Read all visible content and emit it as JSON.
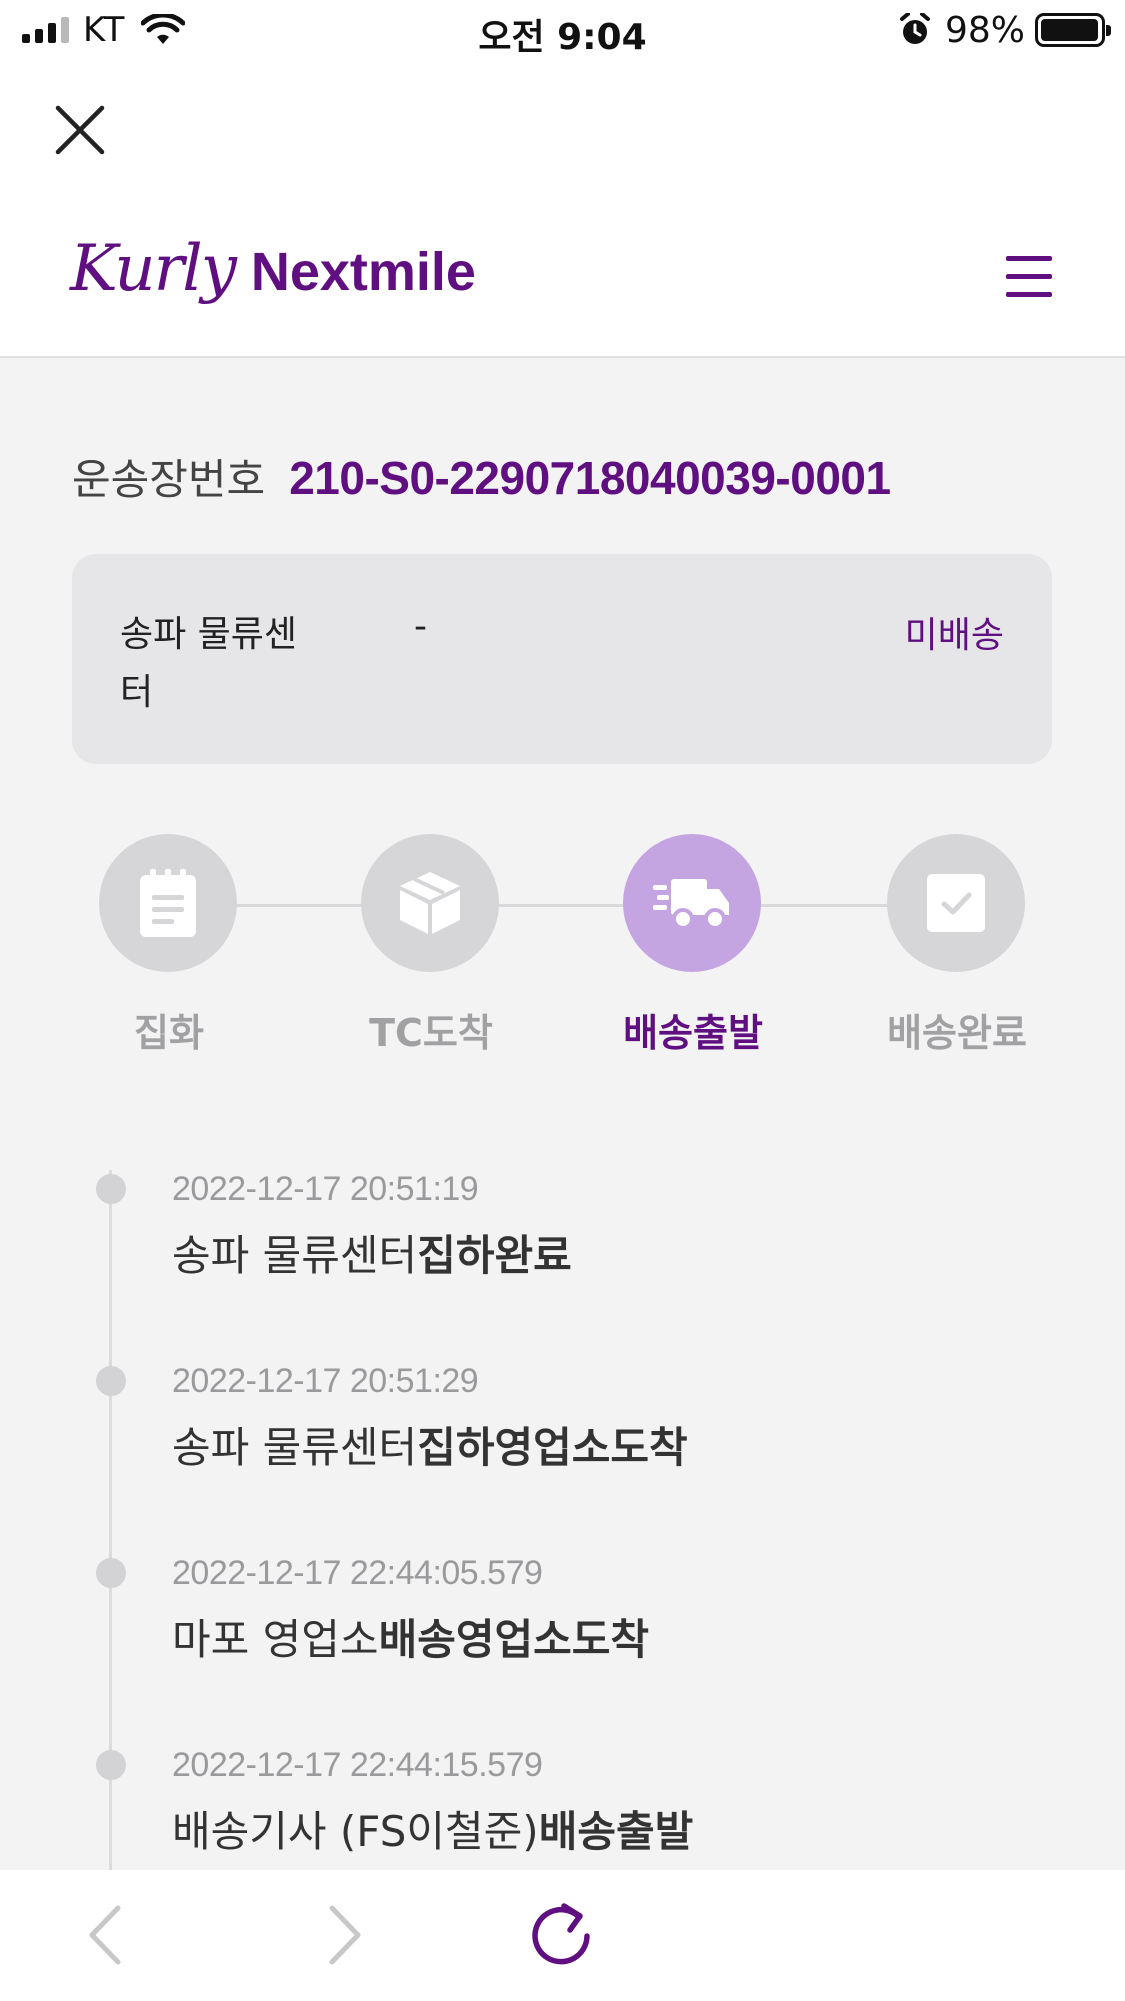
{
  "status_bar": {
    "carrier": "KT",
    "time": "오전 9:04",
    "battery": "98%",
    "battery_level": 0.98
  },
  "header": {
    "logo_script": "Kurly",
    "logo_word": "Nextmile"
  },
  "tracking": {
    "label": "운송장번호",
    "number": "210-S0-2290718040039-0001"
  },
  "info_card": {
    "center_name": "송파 물류센터",
    "value": "-",
    "status": "미배송"
  },
  "steps": [
    {
      "label": "집화",
      "icon": "clipboard-icon",
      "active": false
    },
    {
      "label": "TC도착",
      "icon": "box-icon",
      "active": false
    },
    {
      "label": "배송출발",
      "icon": "truck-icon",
      "active": true
    },
    {
      "label": "배송완료",
      "icon": "check-icon",
      "active": false
    }
  ],
  "timeline": [
    {
      "time": "2022-12-17 20:51:19",
      "place": "송파 물류센터",
      "event": "집하완료"
    },
    {
      "time": "2022-12-17 20:51:29",
      "place": "송파 물류센터",
      "event": "집하영업소도착"
    },
    {
      "time": "2022-12-17 22:44:05.579",
      "place": "마포 영업소",
      "event": "배송영업소도착"
    },
    {
      "time": "2022-12-17 22:44:15.579",
      "place": "배송기사 (FS이철준)",
      "event": "배송출발"
    }
  ],
  "colors": {
    "brand": "#5f0f80",
    "active_step": "#c4a5e2",
    "inactive_step": "#d6d6d8",
    "background": "#f3f3f4"
  }
}
